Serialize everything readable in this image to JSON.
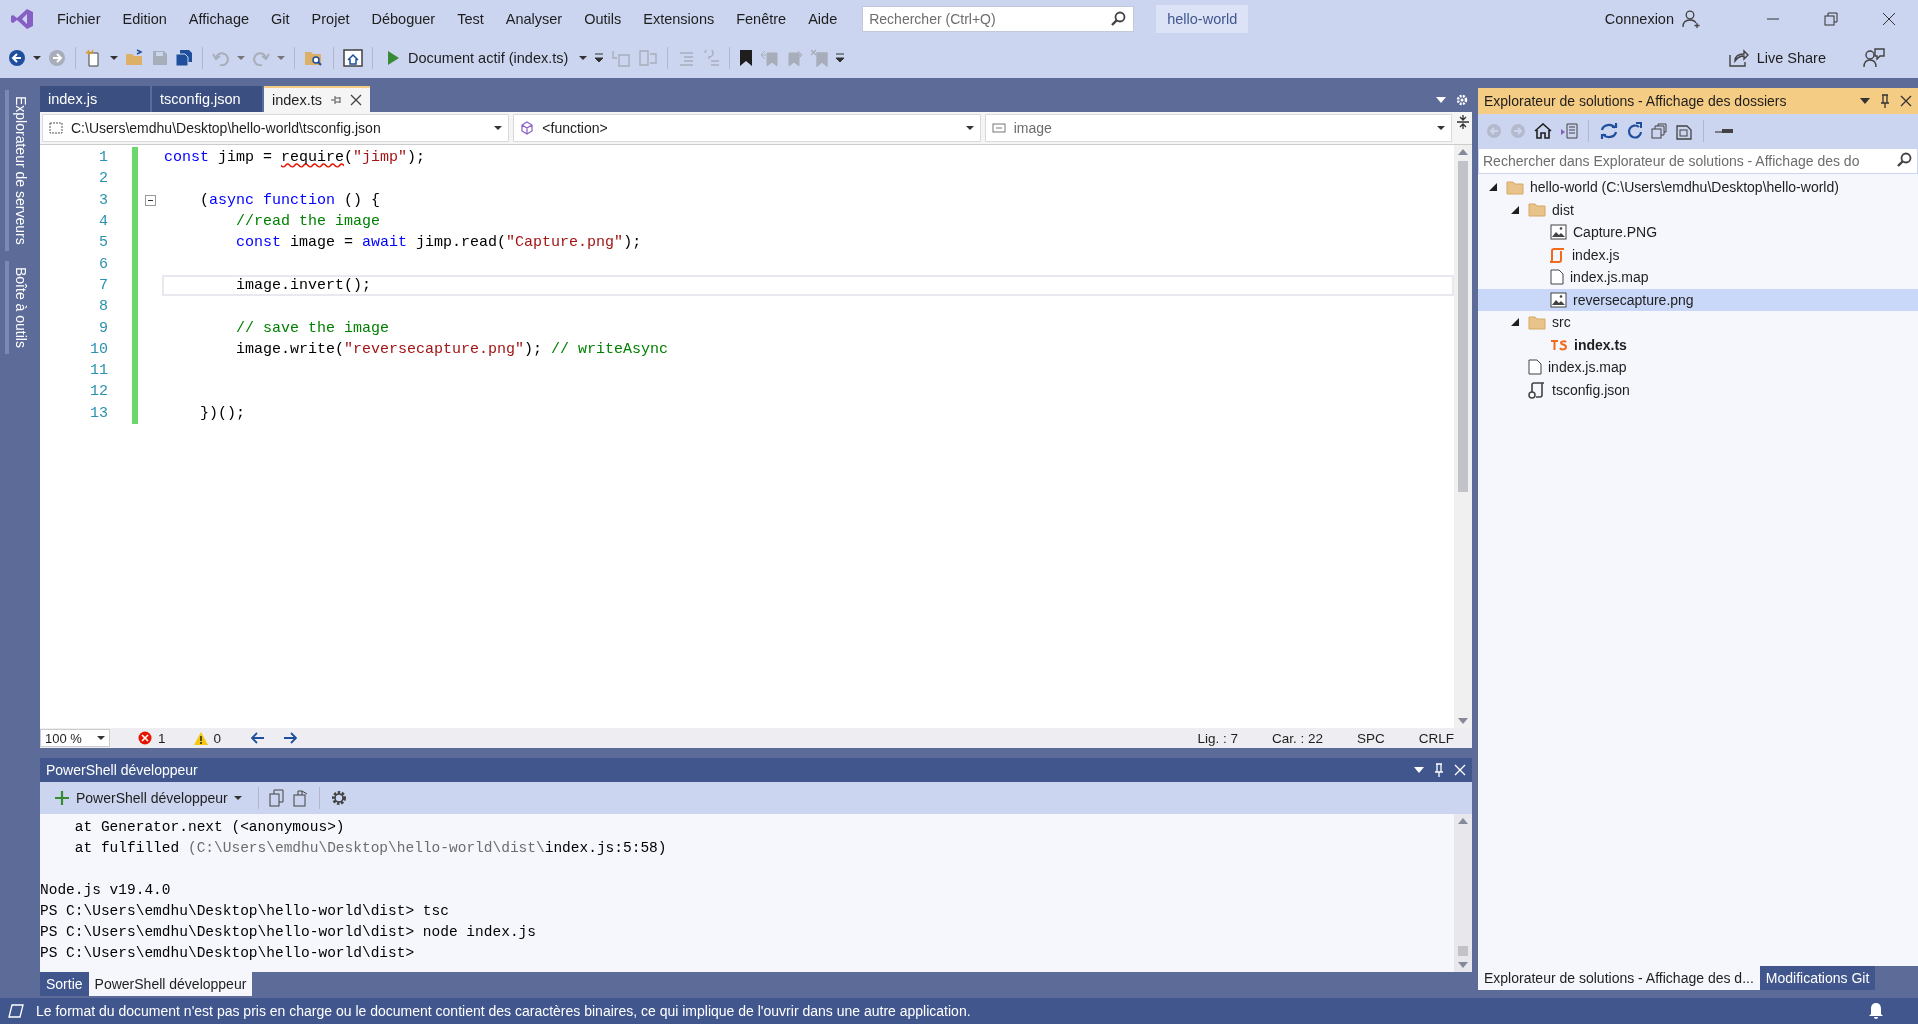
{
  "menu": [
    "Fichier",
    "Edition",
    "Affichage",
    "Git",
    "Projet",
    "Déboguer",
    "Test",
    "Analyser",
    "Outils",
    "Extensions",
    "Fenêtre",
    "Aide"
  ],
  "search": {
    "placeholder": "Rechercher (Ctrl+Q)"
  },
  "solution_name": "hello-world",
  "account": "Connexion",
  "toolbar": {
    "run_target": "Document actif (index.ts)",
    "live_share": "Live Share"
  },
  "side_tabs": [
    "Explorateur de serveurs",
    "Boîte à outils"
  ],
  "editor": {
    "tabs": [
      {
        "label": "index.js",
        "selected": false
      },
      {
        "label": "tsconfig.json",
        "selected": false
      },
      {
        "label": "index.ts",
        "selected": true
      }
    ],
    "nav": {
      "file": "C:\\Users\\emdhu\\Desktop\\hello-world\\tsconfig.json",
      "scope": "<function>",
      "member": "image"
    },
    "lines": [
      {
        "number": "1",
        "current": false,
        "foldable": false,
        "tokens": [
          {
            "text": "const",
            "kind": "keyword"
          },
          {
            "text": " jimp = ",
            "kind": "plain"
          },
          {
            "text": "require",
            "kind": "squiggle"
          },
          {
            "text": "(",
            "kind": "plain"
          },
          {
            "text": "\"jimp\"",
            "kind": "string"
          },
          {
            "text": ");",
            "kind": "plain"
          }
        ]
      },
      {
        "number": "2",
        "current": false,
        "foldable": false
      },
      {
        "number": "3",
        "current": false,
        "foldable": true,
        "tokens": [
          {
            "text": "    (",
            "kind": "plain"
          },
          {
            "text": "async function",
            "kind": "keyword"
          },
          {
            "text": " () {",
            "kind": "plain"
          }
        ]
      },
      {
        "number": "4",
        "current": false,
        "foldable": false,
        "tokens": [
          {
            "text": "        //read the image",
            "kind": "comment"
          }
        ]
      },
      {
        "number": "5",
        "current": false,
        "foldable": false,
        "tokens": [
          {
            "text": "        const",
            "kind": "keyword"
          },
          {
            "text": " image = ",
            "kind": "plain"
          },
          {
            "text": "await",
            "kind": "keyword"
          },
          {
            "text": " jimp.read(",
            "kind": "plain"
          },
          {
            "text": "\"Capture.png\"",
            "kind": "string"
          },
          {
            "text": ");",
            "kind": "plain"
          }
        ]
      },
      {
        "number": "6",
        "current": false,
        "foldable": false
      },
      {
        "number": "7",
        "current": true,
        "foldable": false,
        "tokens": [
          {
            "text": "        image.invert();",
            "kind": "plain"
          }
        ]
      },
      {
        "number": "8",
        "current": false,
        "foldable": false
      },
      {
        "number": "9",
        "current": false,
        "foldable": false,
        "tokens": [
          {
            "text": "        // save the image",
            "kind": "comment"
          }
        ]
      },
      {
        "number": "10",
        "current": false,
        "foldable": false,
        "tokens": [
          {
            "text": "        image.write(",
            "kind": "plain"
          },
          {
            "text": "\"reversecapture.png\"",
            "kind": "string"
          },
          {
            "text": "); ",
            "kind": "plain"
          },
          {
            "text": "// writeAsync",
            "kind": "comment"
          }
        ]
      },
      {
        "number": "11",
        "current": false,
        "foldable": false
      },
      {
        "number": "12",
        "current": false,
        "foldable": false
      },
      {
        "number": "13",
        "current": false,
        "foldable": false,
        "tokens": [
          {
            "text": "    })();",
            "kind": "plain"
          }
        ]
      }
    ],
    "status": {
      "zoom": "100 %",
      "errors": "1",
      "warnings": "0",
      "line": "Lig. : 7",
      "column": "Car. : 22",
      "indent": "SPC",
      "eol": "CRLF"
    }
  },
  "terminal": {
    "title": "PowerShell développeur",
    "profile": "PowerShell développeur",
    "lines": [
      {
        "kind": "text",
        "tokens": [
          {
            "text": "    at Generator.next (<anonymous>)",
            "kind": "plain"
          }
        ]
      },
      {
        "kind": "text",
        "tokens": [
          {
            "text": "    at fulfilled ",
            "kind": "plain"
          },
          {
            "text": "(C:\\Users\\emdhu\\Desktop\\hello-world\\dist\\",
            "kind": "dim"
          },
          {
            "text": "index.js:5:58)",
            "kind": "plain"
          }
        ]
      },
      {
        "kind": "blank"
      },
      {
        "kind": "text",
        "tokens": [
          {
            "text": "Node.js v19.4.0",
            "kind": "plain"
          }
        ]
      },
      {
        "kind": "text",
        "tokens": [
          {
            "text": "PS C:\\Users\\emdhu\\Desktop\\hello-world\\dist> tsc",
            "kind": "plain"
          }
        ]
      },
      {
        "kind": "text",
        "tokens": [
          {
            "text": "PS C:\\Users\\emdhu\\Desktop\\hello-world\\dist> node index.js",
            "kind": "plain"
          }
        ]
      },
      {
        "kind": "text",
        "tokens": [
          {
            "text": "PS C:\\Users\\emdhu\\Desktop\\hello-world\\dist>",
            "kind": "plain"
          }
        ]
      }
    ],
    "tabs": [
      {
        "label": "Sortie",
        "selected": false
      },
      {
        "label": "PowerShell développeur",
        "selected": true
      }
    ]
  },
  "explorer": {
    "title": "Explorateur de solutions - Affichage des dossiers",
    "search": {
      "placeholder": "Rechercher dans Explorateur de solutions - Affichage des do"
    },
    "tree": [
      {
        "label": "hello-world (C:\\Users\\emdhu\\Desktop\\hello-world)",
        "kind": "folder",
        "expanded": true,
        "selected": false,
        "active": false,
        "children": [
          {
            "label": "dist",
            "kind": "folder",
            "expanded": true,
            "selected": false,
            "active": false,
            "children": [
              {
                "label": "Capture.PNG",
                "kind": "image",
                "selected": false,
                "active": false
              },
              {
                "label": "index.js",
                "kind": "script",
                "selected": false,
                "active": false
              },
              {
                "label": "index.js.map",
                "kind": "file",
                "selected": false,
                "active": false
              },
              {
                "label": "reversecapture.png",
                "kind": "image",
                "selected": true,
                "active": false
              }
            ]
          },
          {
            "label": "src",
            "kind": "folder",
            "expanded": true,
            "selected": false,
            "active": false,
            "children": [
              {
                "label": "index.ts",
                "kind": "ts",
                "selected": false,
                "active": true
              }
            ]
          },
          {
            "label": "index.js.map",
            "kind": "file",
            "selected": false,
            "active": false
          },
          {
            "label": "tsconfig.json",
            "kind": "config",
            "selected": false,
            "active": false
          }
        ]
      }
    ],
    "tabs": [
      {
        "label": "Explorateur de solutions - Affichage des d...",
        "selected": true
      },
      {
        "label": "Modifications Git",
        "selected": false
      }
    ]
  },
  "status_bar": {
    "message": "Le format du document n'est pas pris en charge ou le document contient des caractères binaires, ce qui implique de l'ouvrir dans une autre application."
  }
}
